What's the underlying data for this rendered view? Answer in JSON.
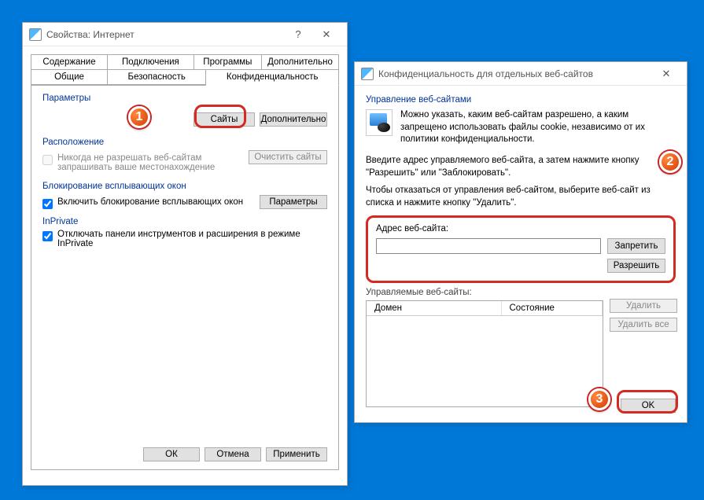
{
  "left": {
    "title": "Свойства: Интернет",
    "tabsTop": [
      "Содержание",
      "Подключения",
      "Программы",
      "Дополнительно"
    ],
    "tabsBottom": [
      "Общие",
      "Безопасность",
      "Конфиденциальность"
    ],
    "params_label": "Параметры",
    "btn_sites": "Сайты",
    "btn_advanced": "Дополнительно",
    "location_label": "Расположение",
    "location_chk": "Никогда не разрешать веб-сайтам\nзапрашивать ваше местонахождение",
    "btn_clear_sites": "Очистить сайты",
    "popup_label": "Блокирование всплывающих окон",
    "popup_chk": "Включить блокирование всплывающих окон",
    "btn_popup_params": "Параметры",
    "inprivate_label": "InPrivate",
    "inprivate_chk": "Отключать панели инструментов и расширения в режиме InPrivate",
    "btn_ok": "ОК",
    "btn_cancel": "Отмена",
    "btn_apply": "Применить"
  },
  "right": {
    "title": "Конфиденциальность для отдельных веб-сайтов",
    "group": "Управление веб-сайтами",
    "desc": "Можно указать, каким веб-сайтам разрешено, а каким запрещено использовать файлы cookie, независимо от их политики конфиденциальности.",
    "instr1": "Введите адрес управляемого веб-сайта, а затем нажмите кнопку \"Разрешить\" или \"Заблокировать\".",
    "instr2": "Чтобы отказаться от управления веб-сайтом, выберите веб-сайт из списка и нажмите кнопку \"Удалить\".",
    "addr_label": "Адрес веб-сайта:",
    "btn_block": "Запретить",
    "btn_allow": "Разрешить",
    "managed_label": "Управляемые веб-сайты:",
    "col_domain": "Домен",
    "col_state": "Состояние",
    "btn_remove": "Удалить",
    "btn_remove_all": "Удалить все",
    "btn_ok": "OK"
  },
  "badges": {
    "b1": "1",
    "b2": "2",
    "b3": "3"
  }
}
